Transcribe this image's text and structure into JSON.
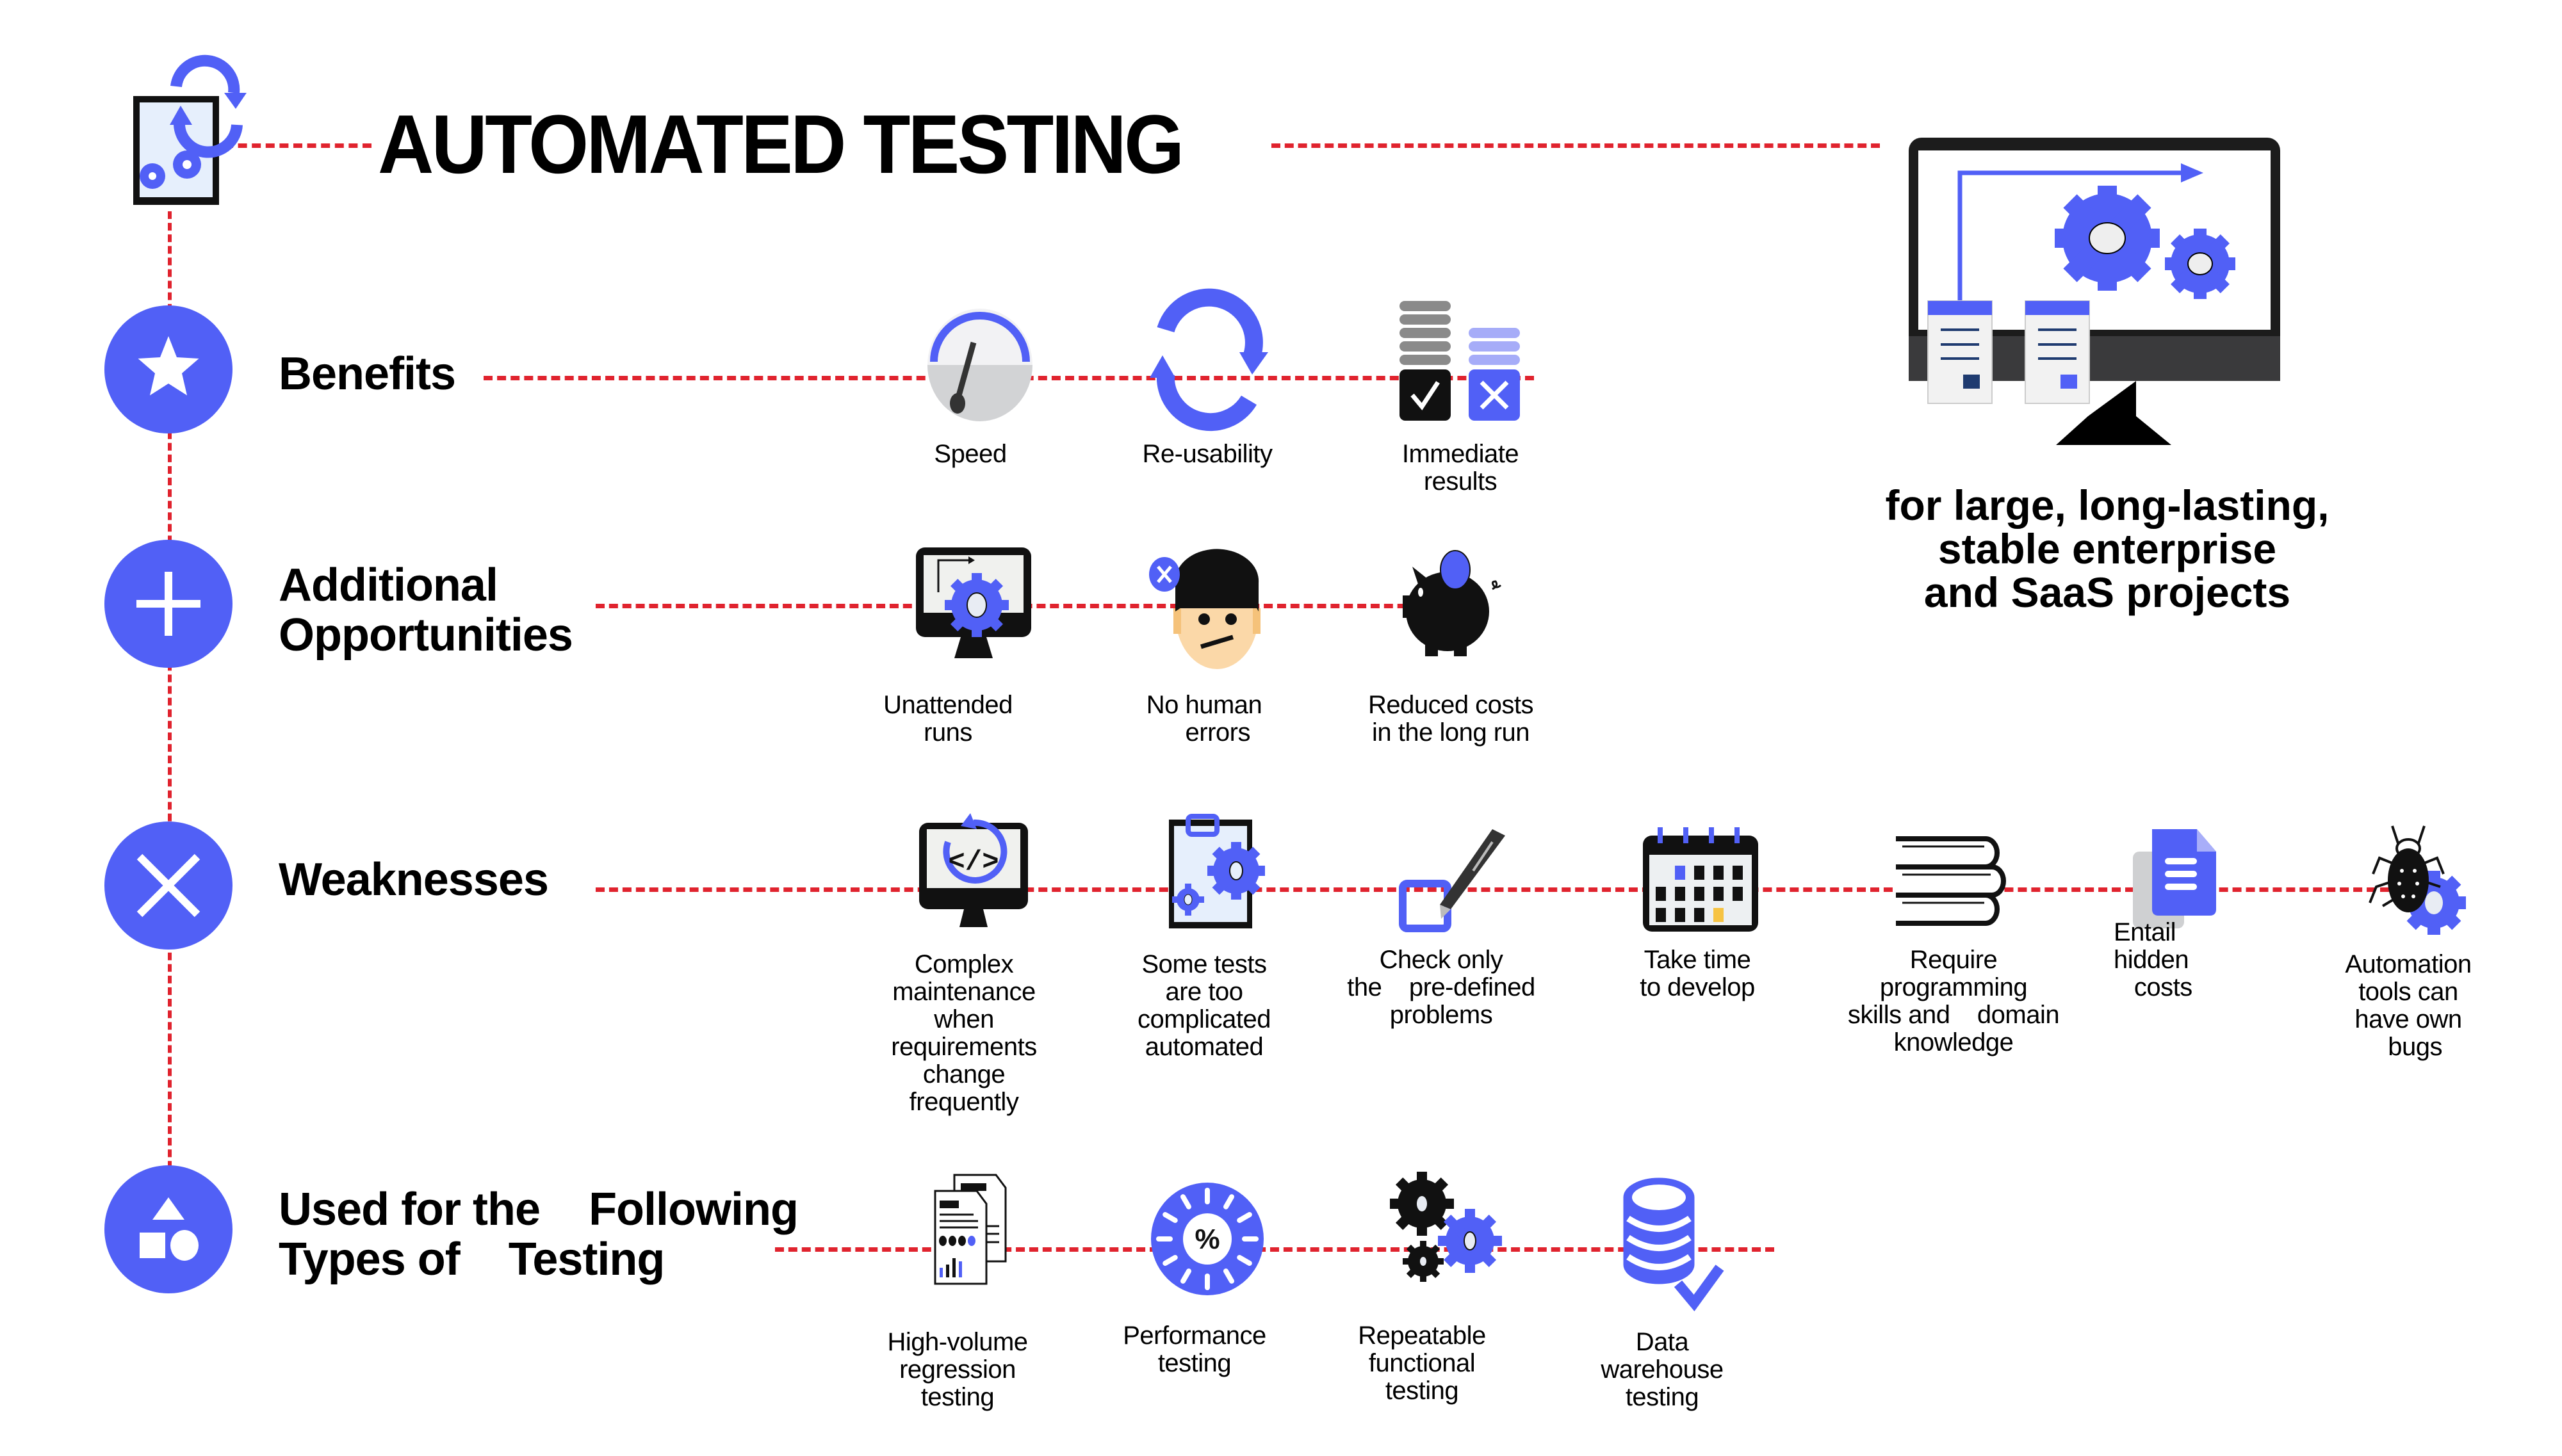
{
  "header": {
    "title": "AUTOMATED TESTING",
    "logo_icon": "document-gears-refresh-icon"
  },
  "hero": {
    "icon": "monitor-gears-workflow-icon",
    "tagline": "for large, long-lasting,\nstable enterprise\nand SaaS projects"
  },
  "colors": {
    "accent": "#5160f6",
    "connector": "#e0232e",
    "text": "#000000"
  },
  "sections": [
    {
      "id": "benefits",
      "label": "Benefits",
      "icon": "star-icon",
      "items": [
        {
          "label": "Speed",
          "icon": "speedometer-icon"
        },
        {
          "label": "Re-usability",
          "icon": "refresh-icon"
        },
        {
          "label": "Immediate\nresults",
          "icon": "pass-fail-results-icon"
        }
      ]
    },
    {
      "id": "additional-opportunities",
      "label": "Additional\nOpportunities",
      "icon": "plus-icon",
      "items": [
        {
          "label": "Unattended\nruns",
          "icon": "monitor-gear-icon"
        },
        {
          "label": "No human\n    errors",
          "icon": "human-error-icon"
        },
        {
          "label": "Reduced costs\nin the long run",
          "icon": "piggy-bank-icon"
        }
      ]
    },
    {
      "id": "weaknesses",
      "label": "Weaknesses",
      "icon": "x-icon",
      "items": [
        {
          "label": "Complex\nmaintenance\nwhen\nrequirements\nchange\nfrequently",
          "icon": "code-refresh-monitor-icon"
        },
        {
          "label": "Some tests\nare too\ncomplicated\nautomated",
          "icon": "clipboard-gears-icon"
        },
        {
          "label": "Check only\nthe    pre-defined\nproblems",
          "icon": "checkbox-pen-icon"
        },
        {
          "label": "Take time\nto develop",
          "icon": "calendar-icon"
        },
        {
          "label": "Require\nprogramming\nskills and    domain\nknowledge",
          "icon": "books-icon"
        },
        {
          "label": "Entail\nhidden\n   costs",
          "icon": "document-icon"
        },
        {
          "label": "Automation\ntools can\nhave own\n  bugs",
          "icon": "bug-gear-icon"
        }
      ]
    },
    {
      "id": "used-for",
      "label": "Used for the    Following\nTypes of    Testing",
      "icon": "shapes-icon",
      "items": [
        {
          "label": "High-volume\nregression\ntesting",
          "icon": "reports-icon"
        },
        {
          "label": "Performance\ntesting",
          "icon": "percent-dial-icon"
        },
        {
          "label": "Repeatable\nfunctional\ntesting",
          "icon": "gears-icon"
        },
        {
          "label": "Data\nwarehouse\ntesting",
          "icon": "database-check-icon"
        }
      ]
    }
  ]
}
